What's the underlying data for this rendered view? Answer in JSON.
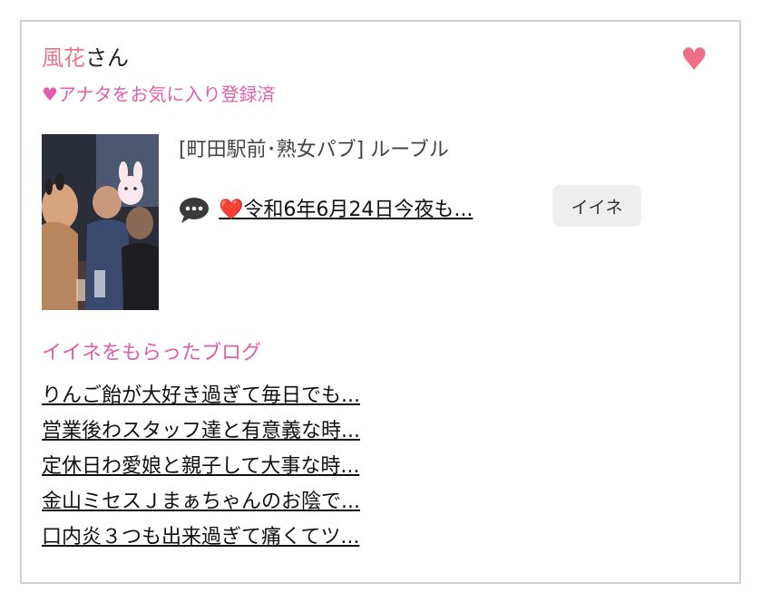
{
  "user": {
    "name": "風花",
    "suffix": "さん",
    "fav_status": "♥アナタをお気に入り登録済"
  },
  "post": {
    "shop": "[町田駅前･熟女パブ]  ルーブル",
    "heart": "❤️",
    "title": "令和6年6月24日今夜も...",
    "like_label": "イイネ"
  },
  "blogs": {
    "heading": "イイネをもらったブログ",
    "items": [
      "りんご飴が大好き過ぎて毎日でも...",
      "営業後わスタッフ達と有意義な時...",
      "定休日わ愛娘と親子して大事な時...",
      "金山ミセスＪまぁちゃんのお陰で...",
      "口内炎３つも出来過ぎて痛くてツ..."
    ]
  },
  "colors": {
    "name": "#e8788f",
    "pink_text": "#e05fa8",
    "heart_button": "#ee6f86",
    "like_button_bg": "#eeeeee"
  },
  "icons": {
    "favorite": "heart-icon",
    "comment": "speech-bubble-icon"
  }
}
